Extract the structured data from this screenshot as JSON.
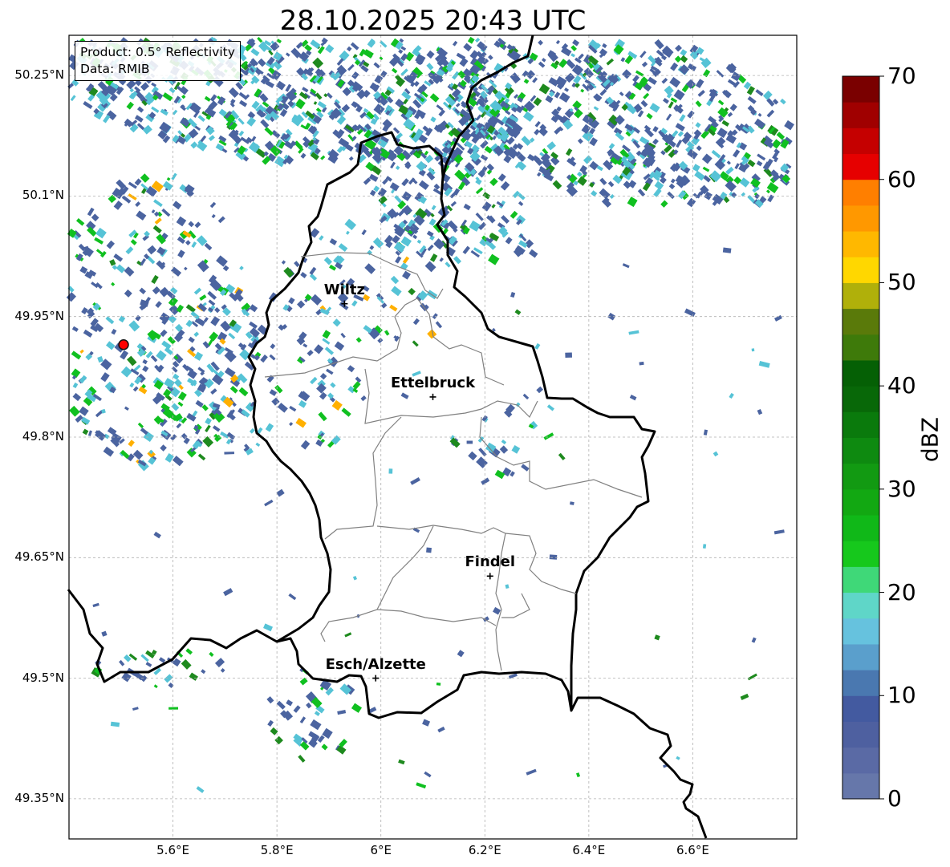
{
  "title": "28.10.2025 20:43 UTC",
  "info": {
    "product": "Product: 0.5° Reflectivity",
    "source": "Data: RMIB"
  },
  "lat_ticks": [
    "50.25°N",
    "50.1°N",
    "49.95°N",
    "49.8°N",
    "49.65°N",
    "49.5°N",
    "49.35°N"
  ],
  "lon_ticks": [
    "5.6°E",
    "5.8°E",
    "6°E",
    "6.2°E",
    "6.4°E",
    "6.6°E"
  ],
  "towns": [
    {
      "name": "Wiltz",
      "lon": 5.93,
      "lat": 49.966
    },
    {
      "name": "Ettelbruck",
      "lon": 6.1,
      "lat": 49.85
    },
    {
      "name": "Findel",
      "lon": 6.21,
      "lat": 49.627
    },
    {
      "name": "Esch/Alzette",
      "lon": 5.99,
      "lat": 49.5
    }
  ],
  "radar_site": {
    "lon": 5.505,
    "lat": 49.915,
    "color": "#ff0000"
  },
  "extent": {
    "lon": [
      5.4,
      6.8
    ],
    "lat": [
      49.3,
      50.3
    ]
  },
  "colorbar": {
    "unit": "dBZ",
    "labels": [
      "70",
      "60",
      "50",
      "40",
      "30",
      "20",
      "10",
      "0"
    ],
    "min": 0,
    "max": 70,
    "step": 2.5,
    "colors": [
      "#6677aa",
      "#5a6aa5",
      "#4e60a0",
      "#435aa0",
      "#4a78b0",
      "#5a9fcc",
      "#66c2de",
      "#5fd6c8",
      "#3fd878",
      "#16c81c",
      "#10b818",
      "#12a812",
      "#129a12",
      "#0e8a10",
      "#0a7a0c",
      "#086808",
      "#056005",
      "#3e7a0a",
      "#5a7a0a",
      "#b0b00a",
      "#ffd700",
      "#ffb800",
      "#ff9800",
      "#ff7f00",
      "#e60000",
      "#c50000",
      "#a00000",
      "#7a0000",
      "#ffe0ff",
      "#ffb0ff",
      "#ff6ff5",
      "#e840f0"
    ]
  },
  "layers": {
    "echo_colors": [
      "#4b64a0",
      "#56c3d6",
      "#10c020",
      "#1e8a1e",
      "#ffb000"
    ]
  }
}
